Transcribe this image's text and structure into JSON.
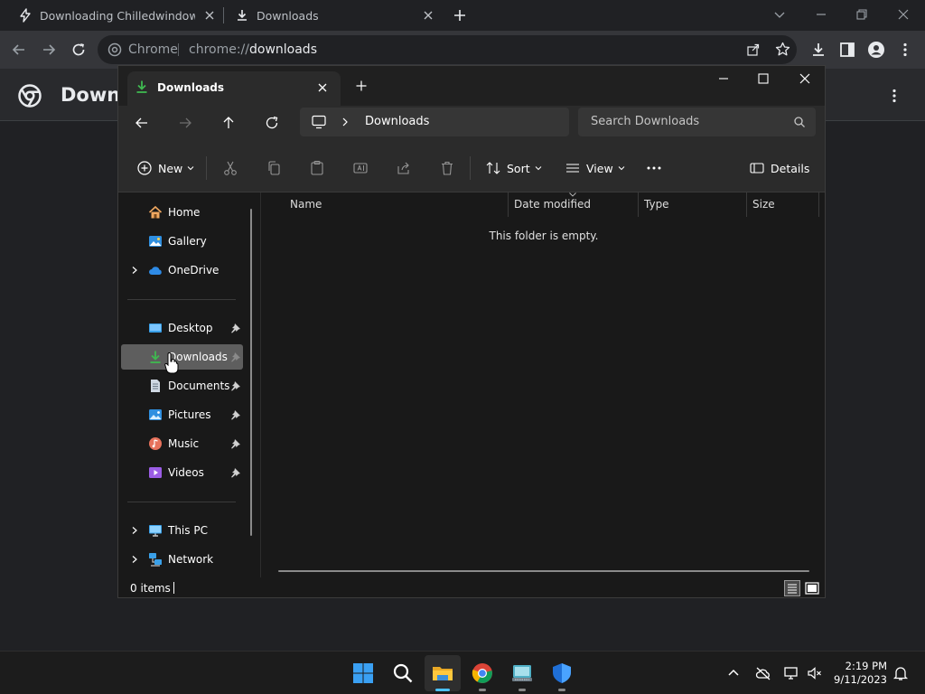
{
  "chrome": {
    "tabs": [
      {
        "title": "Downloading Chilledwindows.exe",
        "icon": "bolt-icon"
      },
      {
        "title": "Downloads",
        "icon": "download-icon"
      }
    ],
    "omnibox": {
      "label": "Chrome",
      "url_scheme": "chrome://",
      "url_host": "downloads"
    },
    "page_title": "Downloads"
  },
  "explorer": {
    "tab_title": "Downloads",
    "address": "Downloads",
    "search_placeholder": "Search Downloads",
    "commands": {
      "new": "New",
      "sort": "Sort",
      "view": "View",
      "details": "Details"
    },
    "sidebar": {
      "top": [
        {
          "label": "Home",
          "icon": "home-icon"
        },
        {
          "label": "Gallery",
          "icon": "gallery-icon"
        },
        {
          "label": "OneDrive",
          "icon": "cloud-icon"
        }
      ],
      "pinned": [
        {
          "label": "Desktop",
          "icon": "desktop-icon"
        },
        {
          "label": "Downloads",
          "icon": "download-icon",
          "selected": true
        },
        {
          "label": "Documents",
          "icon": "documents-icon"
        },
        {
          "label": "Pictures",
          "icon": "pictures-icon"
        },
        {
          "label": "Music",
          "icon": "music-icon"
        },
        {
          "label": "Videos",
          "icon": "videos-icon"
        }
      ],
      "bottom": [
        {
          "label": "This PC",
          "icon": "computer-icon"
        },
        {
          "label": "Network",
          "icon": "network-icon"
        }
      ]
    },
    "columns": [
      "Name",
      "Date modified",
      "Type",
      "Size"
    ],
    "empty_message": "This folder is empty.",
    "status": "0 items"
  },
  "taskbar": {
    "apps": [
      "start-icon",
      "search-icon",
      "file-explorer-icon",
      "chrome-icon",
      "keyboard-app-icon",
      "defender-icon"
    ],
    "time": "2:19 PM",
    "date": "9/11/2023"
  },
  "colors": {
    "accent": "#4cc2ff",
    "download_green": "#3fb950",
    "selection": "#5e5e5e"
  }
}
